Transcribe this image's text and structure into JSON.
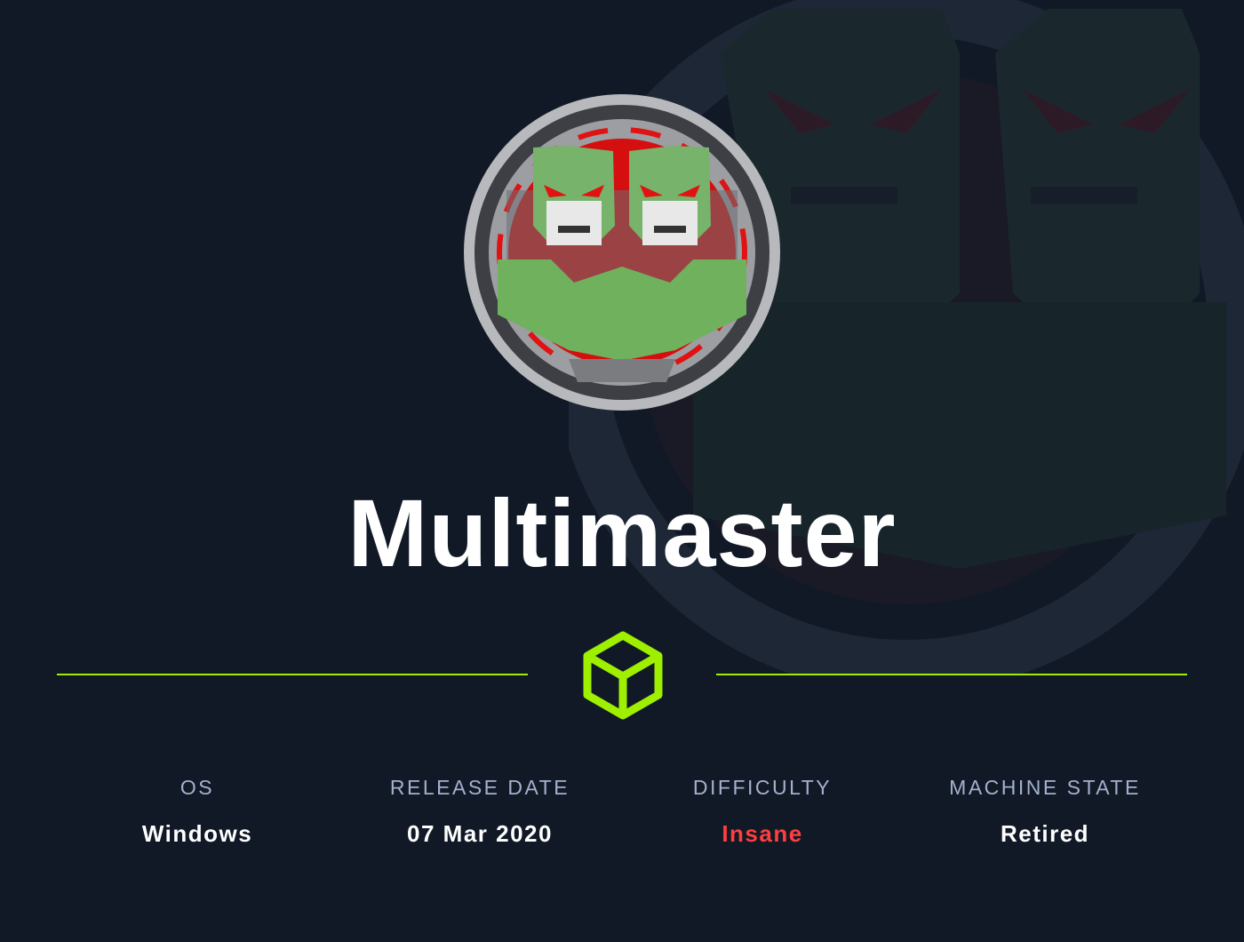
{
  "machine": {
    "name": "Multimaster"
  },
  "stats": [
    {
      "label": "OS",
      "value": "Windows"
    },
    {
      "label": "RELEASE DATE",
      "value": "07 Mar 2020"
    },
    {
      "label": "DIFFICULTY",
      "value": "Insane"
    },
    {
      "label": "MACHINE STATE",
      "value": "Retired"
    }
  ],
  "icons": {
    "avatar": "two-robot-heads-badge-icon",
    "logo": "hackthebox-cube-icon"
  },
  "colors": {
    "background": "#111927",
    "accent": "#9fef00",
    "difficulty": "#ff3e3e",
    "label": "#a4b1cd",
    "text": "#ffffff"
  }
}
